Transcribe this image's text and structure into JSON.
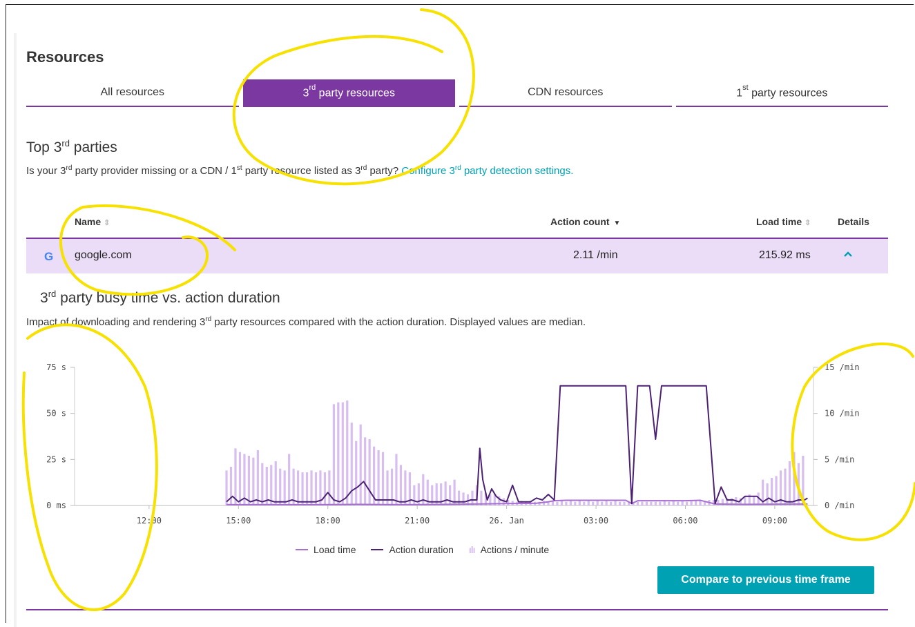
{
  "title": "Resources",
  "tabs": [
    {
      "pre": "All resources",
      "sup": "",
      "post": ""
    },
    {
      "pre": "3",
      "sup": "rd",
      "post": " party resources"
    },
    {
      "pre": "CDN resources",
      "sup": "",
      "post": ""
    },
    {
      "pre": "1",
      "sup": "st",
      "post": " party resources"
    }
  ],
  "active_tab": 1,
  "section": {
    "h_pre": "Top 3",
    "h_sup": "rd",
    "h_post": " parties",
    "q1": "Is your 3",
    "q1_sup": "rd",
    "q2": " party provider missing or a CDN / 1",
    "q2_sup": "st",
    "q3": " party resource listed as 3",
    "q3_sup": "rd",
    "q4": " party? ",
    "link_pre": "Configure 3",
    "link_sup": "rd",
    "link_post": " party detection settings."
  },
  "table": {
    "headers": {
      "name": "Name",
      "action_count": "Action count",
      "load_time": "Load time",
      "details": "Details"
    },
    "row": {
      "icon": "google-g-icon",
      "name": "google.com",
      "action_count": "2.11 /min",
      "load_time": "215.92 ms"
    }
  },
  "detail": {
    "h_pre": "3",
    "h_sup": "rd",
    "h_post": " party busy time vs. action duration",
    "d_pre": "Impact of downloading and rendering 3",
    "d_sup": "rd",
    "d_post": " party resources compared with the action duration. Displayed values are median."
  },
  "legend": {
    "load_time": "Load time",
    "action_duration": "Action duration",
    "actions_per_minute": "Actions / minute"
  },
  "compare_button": "Compare to previous time frame",
  "colors": {
    "accent": "#7c38a1",
    "load_time": "#a66fd0",
    "action_duration": "#4b2173",
    "actions_bar": "#d8bdf0",
    "button": "#00a1b2"
  },
  "chart_data": {
    "type": "line",
    "x_tick_labels": [
      "12:00",
      "15:00",
      "18:00",
      "21:00",
      "26. Jan",
      "03:00",
      "06:00",
      "09:00"
    ],
    "y_left_ticks": [
      "75 s",
      "50 s",
      "25 s",
      "0 ms"
    ],
    "y_right_ticks": [
      "15 /min",
      "10 /min",
      "5 /min",
      "0 /min"
    ],
    "y_left_range_s": [
      0,
      75
    ],
    "y_right_range_per_min": [
      0,
      15
    ],
    "x_range_hours": [
      9.5,
      34.3
    ],
    "series": [
      {
        "name": "Actions / minute",
        "kind": "bar",
        "unit": "/min",
        "x_hours": [
          14.6,
          14.75,
          14.9,
          15.05,
          15.2,
          15.35,
          15.5,
          15.65,
          15.8,
          15.95,
          16.1,
          16.25,
          16.4,
          16.55,
          16.7,
          16.85,
          17.0,
          17.15,
          17.3,
          17.45,
          17.6,
          17.75,
          17.9,
          18.05,
          18.2,
          18.35,
          18.5,
          18.65,
          18.8,
          18.95,
          19.1,
          19.25,
          19.4,
          19.55,
          19.7,
          19.85,
          20.0,
          20.15,
          20.3,
          20.45,
          20.6,
          20.75,
          20.9,
          21.05,
          21.2,
          21.35,
          21.5,
          21.65,
          21.8,
          21.95,
          22.1,
          22.25,
          22.4,
          22.55,
          22.7,
          22.85,
          23.0,
          23.15,
          23.3,
          23.45,
          23.6,
          23.75,
          23.9,
          24.05,
          24.2,
          24.35,
          24.5,
          24.65,
          24.8,
          24.95,
          25.1,
          25.25,
          25.4,
          25.55,
          25.7,
          25.85,
          26.0,
          26.15,
          26.3,
          26.45,
          26.6,
          26.75,
          26.9,
          27.05,
          27.2,
          27.35,
          27.5,
          27.65,
          27.8,
          27.95,
          28.1,
          28.25,
          28.4,
          28.55,
          28.7,
          28.85,
          29.0,
          29.15,
          29.3,
          29.45,
          29.6,
          29.75,
          29.9,
          30.05,
          30.2,
          30.35,
          30.5,
          30.65,
          30.8,
          30.95,
          31.1,
          31.25,
          31.4,
          31.55,
          31.7,
          31.85,
          32.0,
          32.15,
          32.3,
          32.45,
          32.6,
          32.75,
          32.9,
          33.05,
          33.2,
          33.35,
          33.5,
          33.65,
          33.8,
          33.95,
          34.1
        ],
        "values": [
          3.8,
          4.2,
          6.2,
          5.8,
          5.6,
          5.4,
          5.2,
          6.0,
          4.6,
          4.2,
          4.4,
          4.8,
          4.0,
          3.8,
          5.6,
          4.0,
          3.8,
          3.6,
          3.6,
          3.8,
          3.6,
          3.8,
          3.6,
          3.8,
          11.0,
          11.2,
          11.2,
          11.4,
          9.0,
          7.0,
          8.8,
          7.4,
          7.2,
          6.4,
          6.0,
          5.8,
          3.8,
          4.0,
          5.6,
          4.4,
          3.8,
          3.6,
          2.2,
          2.4,
          3.4,
          2.8,
          2.2,
          2.4,
          2.4,
          2.6,
          2.2,
          2.8,
          1.6,
          1.4,
          1.2,
          1.6,
          2.2,
          1.6,
          1.4,
          1.2,
          1.2,
          1.0,
          0.8,
          0.6,
          0.5,
          0.4,
          0.5,
          0.4,
          0.5,
          0.4,
          0.4,
          0.5,
          0.4,
          0.5,
          0.4,
          0.5,
          0.4,
          0.5,
          0.4,
          0.5,
          0.4,
          0.5,
          0.4,
          0.5,
          0.4,
          0.5,
          0.4,
          0.5,
          0.4,
          0.4,
          0.4,
          0.4,
          0.4,
          0.4,
          0.4,
          0.4,
          0.4,
          0.4,
          0.6,
          0.4,
          0.5,
          0.4,
          0.5,
          0.4,
          0.5,
          0.6,
          0.5,
          0.4,
          0.6,
          0.6,
          0.6,
          0.7,
          0.8,
          0.8,
          0.9,
          0.8,
          1.0,
          1.2,
          1.0,
          1.4,
          2.8,
          2.4,
          3.0,
          3.2,
          3.8,
          4.0,
          4.8,
          5.8,
          4.6,
          5.4
        ]
      },
      {
        "name": "Action duration",
        "kind": "line",
        "unit": "s",
        "x_hours": [
          14.6,
          14.8,
          15.0,
          15.2,
          15.4,
          15.6,
          15.8,
          16.0,
          16.2,
          16.4,
          16.6,
          16.8,
          17.0,
          17.2,
          17.4,
          17.6,
          17.8,
          18.0,
          18.2,
          18.4,
          18.6,
          18.8,
          19.0,
          19.2,
          19.4,
          19.6,
          19.8,
          20.0,
          20.2,
          20.4,
          20.6,
          20.8,
          21.0,
          21.2,
          21.4,
          21.6,
          21.8,
          22.0,
          22.2,
          22.4,
          22.6,
          22.8,
          23.0,
          23.1,
          23.2,
          23.35,
          23.5,
          23.65,
          23.8,
          24.0,
          24.2,
          24.4,
          24.6,
          24.8,
          25.0,
          25.2,
          25.4,
          25.6,
          25.8,
          26.0,
          26.2,
          26.6,
          27.0,
          27.6,
          28.0,
          28.2,
          28.4,
          28.6,
          28.8,
          29.0,
          29.2,
          29.4,
          29.6,
          29.8,
          30.0,
          30.2,
          30.5,
          30.7,
          31.0,
          31.2,
          31.4,
          31.6,
          31.8,
          32.0,
          32.2,
          32.4,
          32.6,
          32.8,
          33.0,
          33.2,
          33.4,
          33.6,
          33.8,
          34.0,
          34.1
        ],
        "values": [
          2,
          5,
          2,
          4,
          2,
          3,
          2,
          3,
          2,
          2,
          2,
          3,
          2,
          2,
          2,
          2,
          3,
          7,
          3,
          2,
          4,
          8,
          10,
          13,
          8,
          3,
          3,
          3,
          3,
          2,
          2,
          3,
          2,
          3,
          2,
          2,
          2,
          3,
          2,
          2,
          2,
          3,
          3,
          31,
          14,
          3,
          9,
          5,
          3,
          2,
          11,
          2,
          2,
          2,
          4,
          3,
          6,
          3,
          65,
          65,
          65,
          65,
          65,
          65,
          65,
          1,
          65,
          65,
          65,
          36,
          65,
          65,
          65,
          65,
          65,
          65,
          65,
          65,
          1,
          10,
          3,
          3,
          2,
          5,
          5,
          5,
          2,
          4,
          2,
          3,
          2,
          2,
          3,
          3,
          4
        ]
      },
      {
        "name": "Load time",
        "kind": "line",
        "unit": "s",
        "x_hours": [
          14.6,
          15.0,
          16.0,
          17.0,
          18.0,
          19.0,
          20.0,
          21.0,
          22.0,
          23.0,
          24.0,
          25.0,
          25.4,
          25.6,
          26.0,
          27.0,
          28.0,
          28.2,
          28.4,
          29.0,
          30.0,
          30.5,
          31.0,
          32.0,
          33.0,
          34.0,
          34.1
        ],
        "values": [
          0.5,
          0.4,
          0.5,
          0.4,
          0.5,
          0.6,
          0.5,
          0.5,
          0.6,
          0.8,
          1.0,
          1.2,
          2.0,
          2.6,
          2.8,
          2.8,
          2.8,
          1.0,
          2.6,
          2.6,
          2.6,
          2.8,
          0.8,
          0.6,
          0.7,
          0.8,
          0.8
        ]
      }
    ]
  }
}
